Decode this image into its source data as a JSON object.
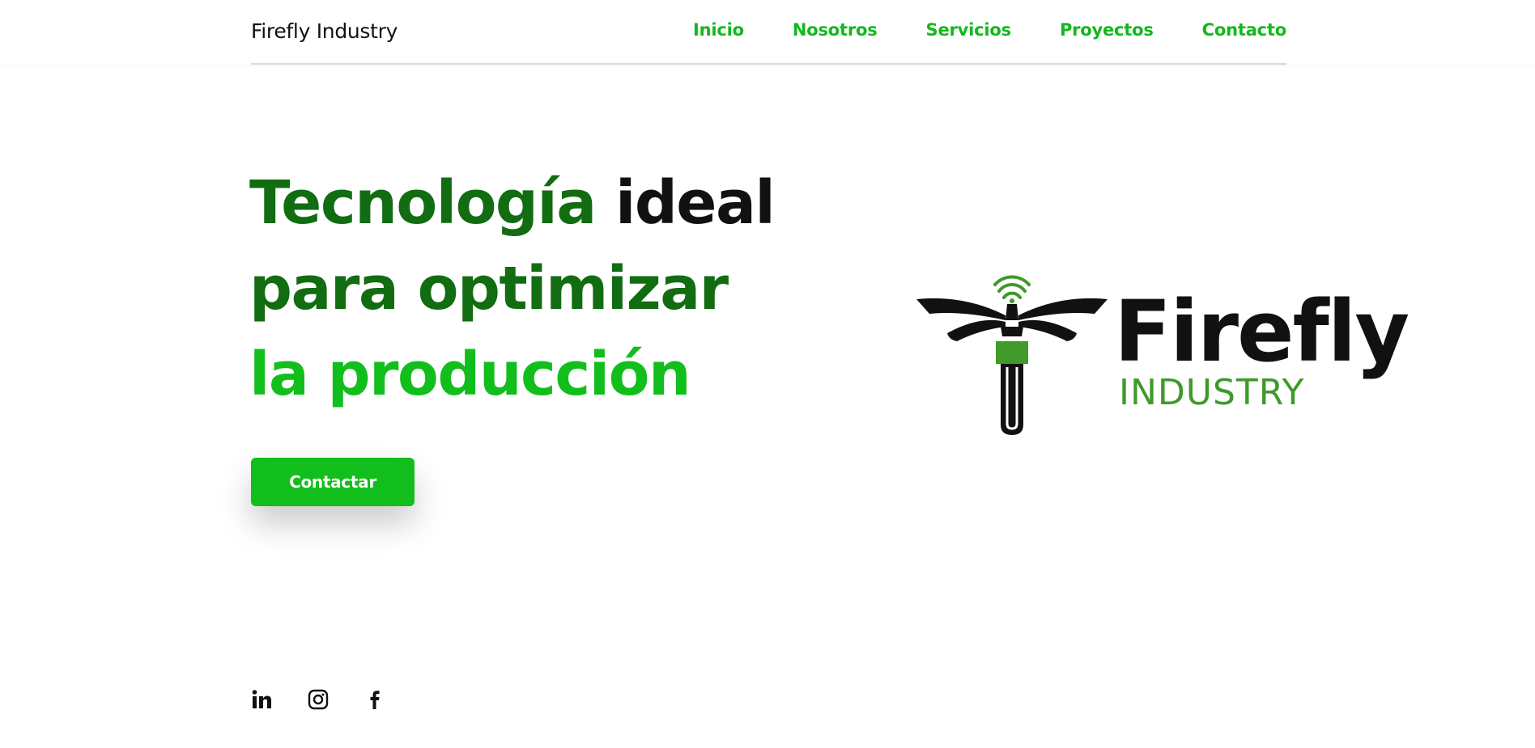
{
  "header": {
    "brand": "Firefly Industry",
    "nav": [
      "Inicio",
      "Nosotros",
      "Servicios",
      "Proyectos",
      "Contacto"
    ]
  },
  "hero": {
    "line1_part1": "Tecnología",
    "line1_part2": "ideal",
    "line2": "para optimizar",
    "line3": "la producción",
    "cta_label": "Contactar"
  },
  "logo": {
    "word": "Firefly",
    "subword": "INDUSTRY"
  },
  "socials": [
    {
      "icon": "linkedin-icon"
    },
    {
      "icon": "instagram-icon"
    },
    {
      "icon": "facebook-icon"
    }
  ],
  "colors": {
    "accent": "#12be1c",
    "dark_green": "#116c12",
    "logo_green": "#3f9a2a",
    "text": "#111111"
  }
}
